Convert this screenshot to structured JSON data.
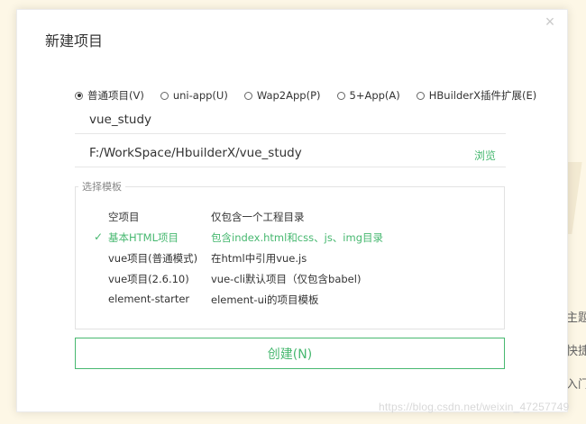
{
  "dialog": {
    "title": "新建项目",
    "close_glyph": "×"
  },
  "project_types": [
    {
      "label": "普通项目(V)",
      "checked": true
    },
    {
      "label": "uni-app(U)",
      "checked": false
    },
    {
      "label": "Wap2App(P)",
      "checked": false
    },
    {
      "label": "5+App(A)",
      "checked": false
    },
    {
      "label": "HBuilderX插件扩展(E)",
      "checked": false
    }
  ],
  "project_name": "vue_study",
  "project_path": "F:/WorkSpace/HbuilderX/vue_study",
  "browse_label": "浏览",
  "templates": {
    "legend": "选择模板",
    "items": [
      {
        "name": "空项目",
        "desc": "仅包含一个工程目录",
        "selected": false
      },
      {
        "name": "基本HTML项目",
        "desc": "包含index.html和css、js、img目录",
        "selected": true
      },
      {
        "name": "vue项目(普通模式)",
        "desc": "在html中引用vue.js",
        "selected": false
      },
      {
        "name": "vue项目(2.6.10)",
        "desc": "vue-cli默认项目（仅包含babel)",
        "selected": false
      },
      {
        "name": "element-starter",
        "desc": "element-ui的项目模板",
        "selected": false
      }
    ]
  },
  "create_label": "创建(N)",
  "background": {
    "side_texts": [
      "主题",
      "快捷",
      "入门"
    ]
  },
  "watermark": "https://blog.csdn.net/weixin_47257749",
  "colors": {
    "accent": "#47b870",
    "page_background": "#fdf7e6"
  }
}
